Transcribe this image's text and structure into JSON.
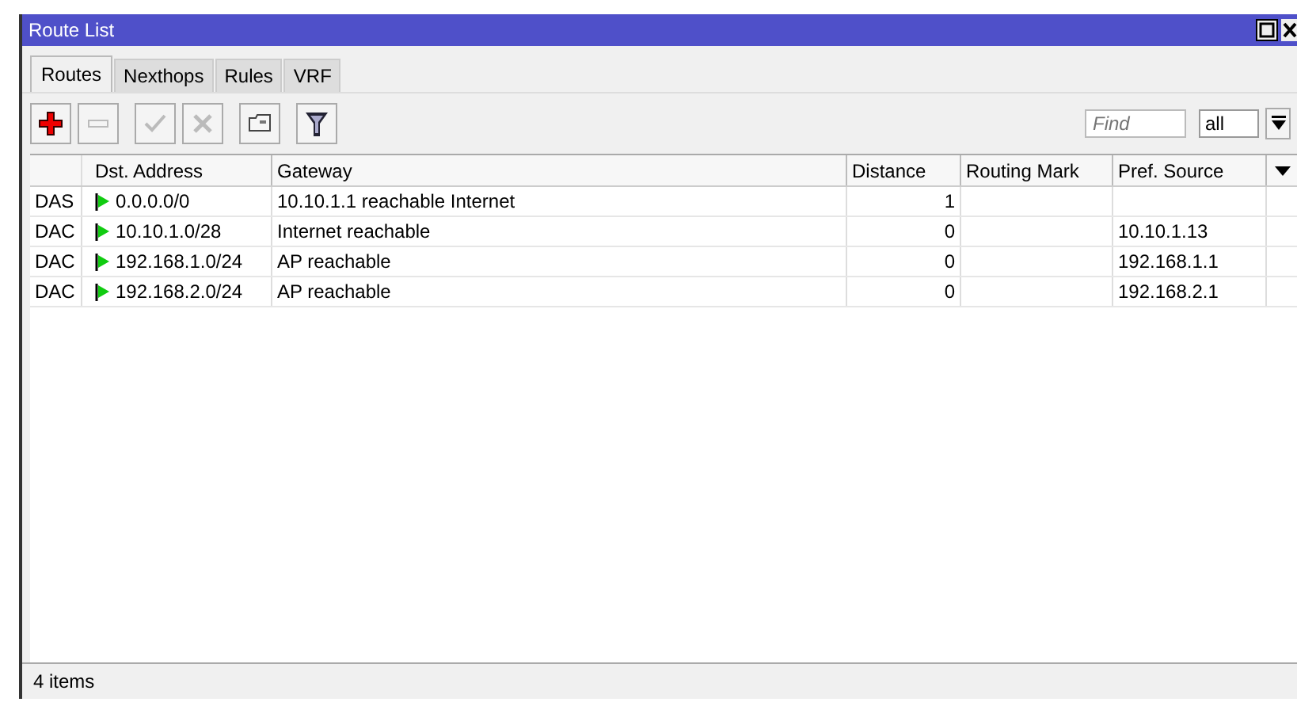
{
  "window": {
    "title": "Route List"
  },
  "tabs": [
    {
      "label": "Routes",
      "selected": true
    },
    {
      "label": "Nexthops",
      "selected": false
    },
    {
      "label": "Rules",
      "selected": false
    },
    {
      "label": "VRF",
      "selected": false
    }
  ],
  "toolbar": [
    {
      "kind": "add",
      "disabled": false
    },
    {
      "kind": "remove",
      "disabled": true
    },
    {
      "kind": "enable",
      "disabled": true
    },
    {
      "kind": "disable",
      "disabled": true
    },
    {
      "kind": "comment",
      "disabled": false
    },
    {
      "kind": "filter",
      "disabled": false
    }
  ],
  "search": {
    "placeholder": "Find",
    "scope": "all"
  },
  "table": {
    "columns": [
      "Dst. Address",
      "Gateway",
      "Distance",
      "Routing Mark",
      "Pref. Source"
    ],
    "rows": [
      {
        "flags": "DAS",
        "dst": "0.0.0.0/0",
        "gateway": "10.10.1.1 reachable Internet",
        "distance": "1",
        "pref_source": ""
      },
      {
        "flags": "DAC",
        "dst": "10.10.1.0/28",
        "gateway": "Internet reachable",
        "distance": "0",
        "pref_source": "10.10.1.13"
      },
      {
        "flags": "DAC",
        "dst": "192.168.1.0/24",
        "gateway": "AP reachable",
        "distance": "0",
        "pref_source": "192.168.1.1"
      },
      {
        "flags": "DAC",
        "dst": "192.168.2.0/24",
        "gateway": "AP reachable",
        "distance": "0",
        "pref_source": "192.168.2.1"
      }
    ]
  },
  "status_bar": "4 items"
}
